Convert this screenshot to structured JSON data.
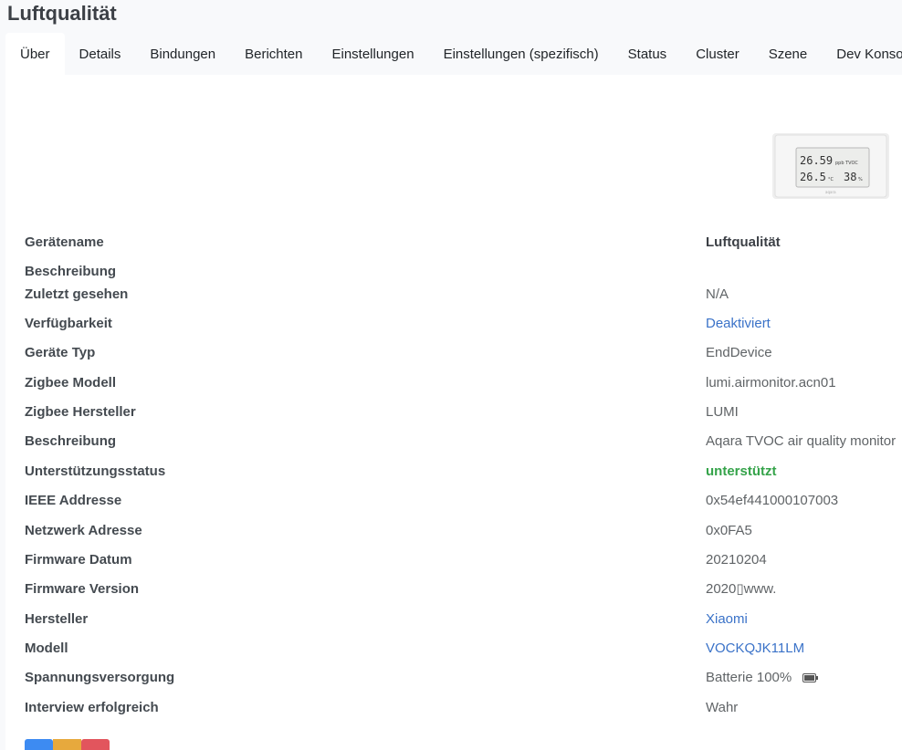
{
  "page": {
    "title": "Luftqualität"
  },
  "tabs": [
    {
      "label": "Über"
    },
    {
      "label": "Details"
    },
    {
      "label": "Bindungen"
    },
    {
      "label": "Berichten"
    },
    {
      "label": "Einstellungen"
    },
    {
      "label": "Einstellungen (spezifisch)"
    },
    {
      "label": "Status"
    },
    {
      "label": "Cluster"
    },
    {
      "label": "Szene"
    },
    {
      "label": "Dev Konsole"
    }
  ],
  "device_image": {
    "line1": "26.59",
    "line1_unit": "ppb  TVOC",
    "line2a": "26.5",
    "line2a_unit": "°C",
    "line2b": "38",
    "line2b_unit": "%",
    "brand": "aqara"
  },
  "info": [
    {
      "label": "Gerätename",
      "value": "Luftqualität"
    },
    {
      "label": "Beschreibung",
      "value": ""
    },
    {
      "label": "Zuletzt gesehen",
      "value": "N/A"
    },
    {
      "label": "Verfügbarkeit",
      "value": "Deaktiviert"
    },
    {
      "label": "Geräte Typ",
      "value": "EndDevice"
    },
    {
      "label": "Zigbee Modell",
      "value": "lumi.airmonitor.acn01"
    },
    {
      "label": "Zigbee Hersteller",
      "value": "LUMI"
    },
    {
      "label": "Beschreibung",
      "value": "Aqara TVOC air quality monitor"
    },
    {
      "label": "Unterstützungsstatus",
      "value": "unterstützt"
    },
    {
      "label": "IEEE Addresse",
      "value": "0x54ef441000107003"
    },
    {
      "label": "Netzwerk Adresse",
      "value": "0x0FA5"
    },
    {
      "label": "Firmware Datum",
      "value": "20210204"
    },
    {
      "label": "Firmware Version",
      "value": "2020▯www."
    },
    {
      "label": "Hersteller",
      "value": "Xiaomi"
    },
    {
      "label": "Modell",
      "value": "VOCKQJK11LM"
    },
    {
      "label": "Spannungsversorgung",
      "value": "Batterie 100%"
    },
    {
      "label": "Interview erfolgreich",
      "value": "Wahr"
    }
  ],
  "icons": {
    "battery": "battery-icon"
  },
  "colors": {
    "link": "#3a72c8",
    "success": "#35a34a",
    "btn_blue": "#3d8bf2",
    "btn_yellow": "#e7a93d",
    "btn_red": "#e2555d"
  }
}
